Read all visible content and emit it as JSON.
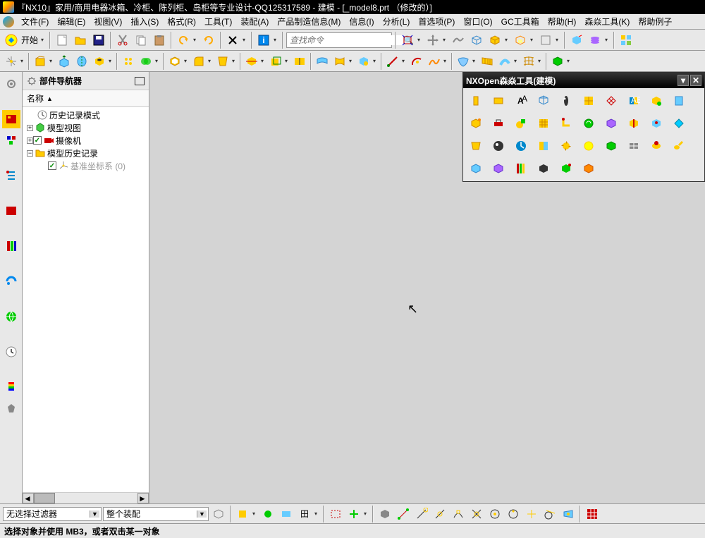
{
  "title": "『NX10』家用/商用电器冰箱、冷柜、陈列柜、岛柜等专业设计-QQ125317589 - 建模 - [_model8.prt （修改的）]",
  "menu": [
    "文件(F)",
    "编辑(E)",
    "视图(V)",
    "插入(S)",
    "格式(R)",
    "工具(T)",
    "装配(A)",
    "产品制造信息(M)",
    "信息(I)",
    "分析(L)",
    "首选项(P)",
    "窗口(O)",
    "GC工具箱",
    "帮助(H)",
    "森焱工具(K)",
    "帮助例子"
  ],
  "start_label": "开始",
  "search_placeholder": "查找命令",
  "nav": {
    "title": "部件导航器",
    "col": "名称",
    "items": [
      {
        "indent": 0,
        "exp": "",
        "icon": "clock",
        "label": "历史记录模式"
      },
      {
        "indent": 0,
        "exp": "+",
        "icon": "model",
        "label": "模型视图"
      },
      {
        "indent": 0,
        "exp": "+",
        "chk": true,
        "icon": "camera",
        "label": "摄像机"
      },
      {
        "indent": 0,
        "exp": "-",
        "icon": "folder",
        "label": "模型历史记录"
      },
      {
        "indent": 1,
        "exp": "",
        "chk": true,
        "icon": "csys",
        "label": "基准坐标系 (0)",
        "gray": true
      }
    ]
  },
  "floatwin": {
    "title": "NXOpen森焱工具(建模)"
  },
  "bottom": {
    "filter": "无选择过滤器",
    "assembly": "整个装配"
  },
  "status": "选择对象并使用 MB3，或者双击某一对象"
}
